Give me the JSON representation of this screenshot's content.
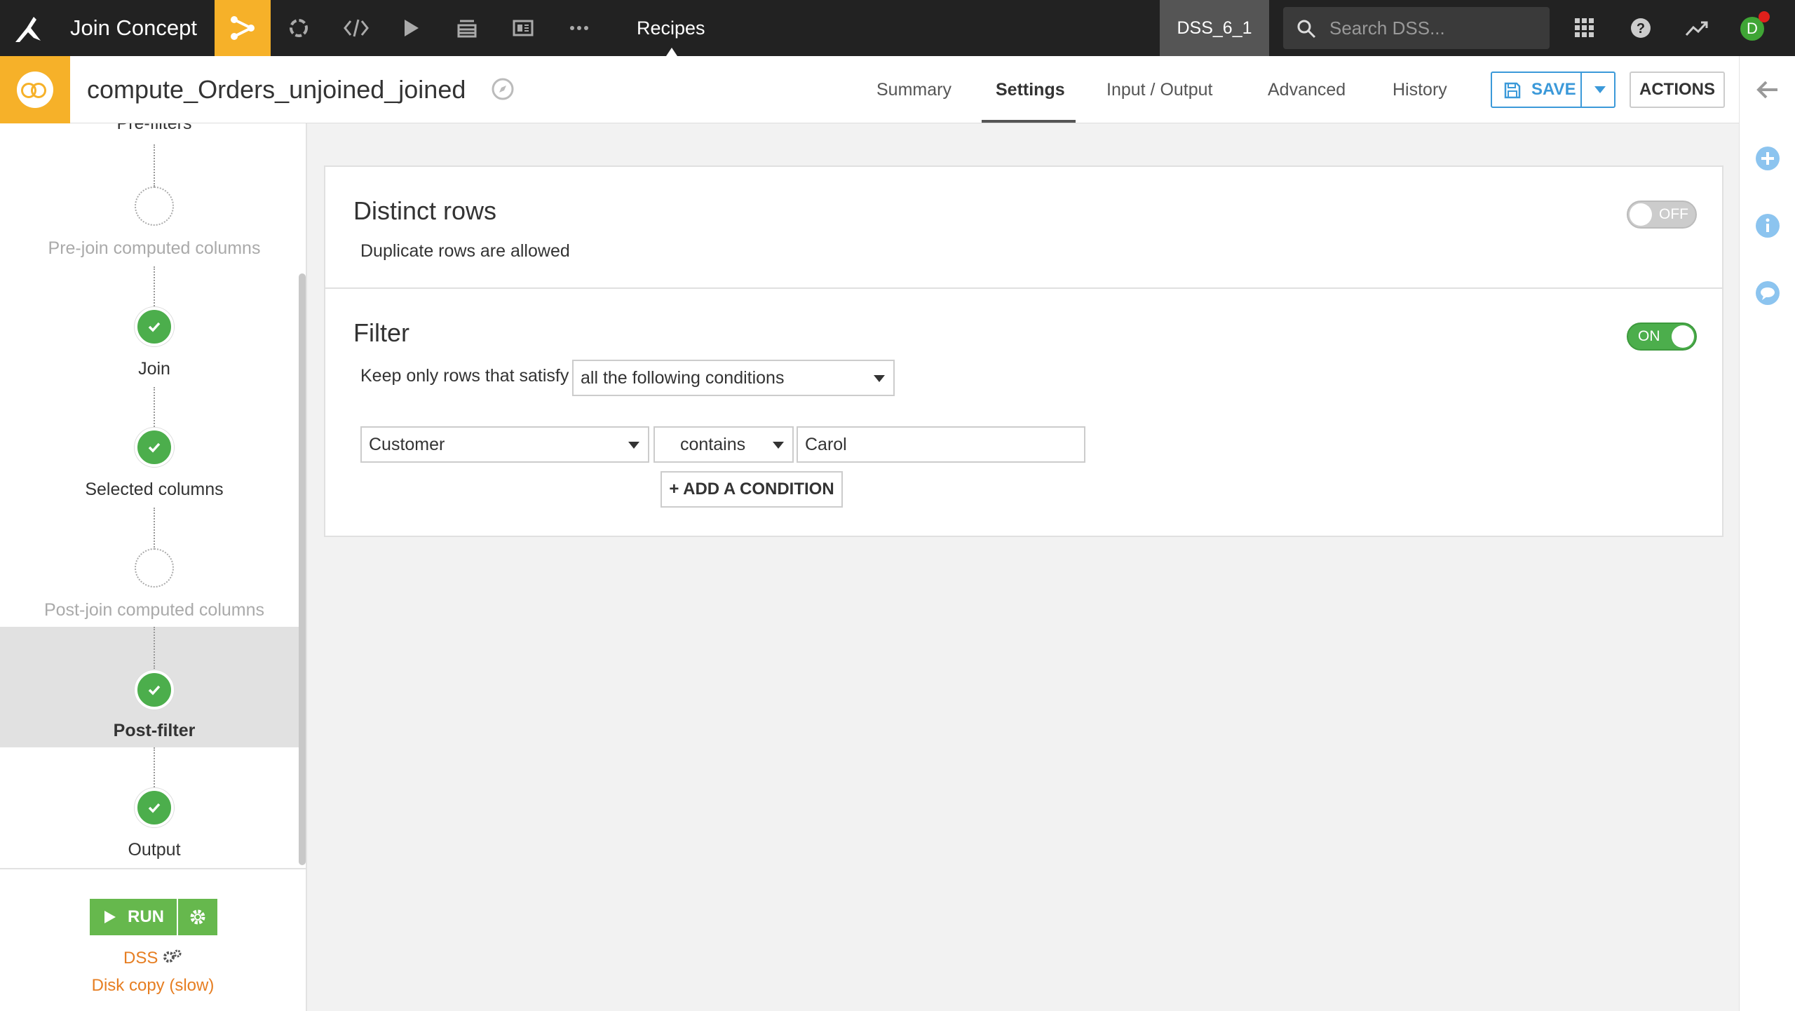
{
  "topnav": {
    "project_name": "Join Concept",
    "section": "Recipes",
    "instance": "DSS_6_1",
    "search_placeholder": "Search DSS...",
    "avatar_initial": "D",
    "icons": [
      "flow-icon",
      "jobs-icon",
      "code-icon",
      "run-icon",
      "stack-icon",
      "dashboard-icon",
      "more-icon"
    ],
    "accent": "#f6b129"
  },
  "header": {
    "recipe_name": "compute_Orders_unjoined_joined",
    "tabs": [
      "Summary",
      "Settings",
      "Input / Output",
      "Advanced",
      "History"
    ],
    "active_tab": "Settings",
    "save_label": "SAVE",
    "actions_label": "ACTIONS"
  },
  "steps": [
    {
      "label": "Pre-filters",
      "state": "partial"
    },
    {
      "label": "Pre-join computed columns",
      "state": "empty"
    },
    {
      "label": "Join",
      "state": "done"
    },
    {
      "label": "Selected columns",
      "state": "done"
    },
    {
      "label": "Post-join computed columns",
      "state": "empty"
    },
    {
      "label": "Post-filter",
      "state": "done",
      "active": true
    },
    {
      "label": "Output",
      "state": "done"
    }
  ],
  "run": {
    "label": "RUN",
    "engine": "DSS",
    "engine_detail": "Disk copy (slow)"
  },
  "distinct": {
    "title": "Distinct rows",
    "description": "Duplicate rows are allowed",
    "toggle": "OFF"
  },
  "filter": {
    "title": "Filter",
    "prompt": "Keep only rows that satisfy",
    "mode": "all the following conditions",
    "toggle": "ON",
    "condition": {
      "column": "Customer",
      "operator": "contains",
      "value": "Carol"
    },
    "add_label": "+ ADD A CONDITION"
  },
  "colors": {
    "success": "#4cae4c",
    "link": "#3b99d9",
    "warning": "#e67e22"
  }
}
